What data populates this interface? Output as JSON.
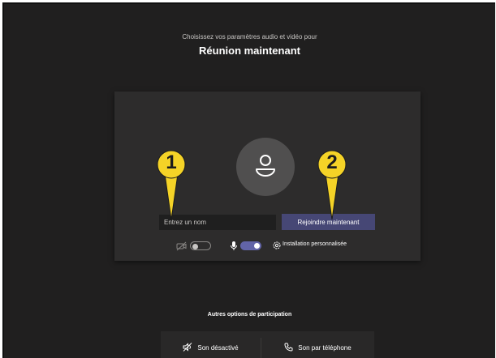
{
  "header": {
    "subtitle": "Choisissez vos paramètres audio et vidéo pour",
    "title": "Réunion maintenant"
  },
  "prejoin": {
    "name_placeholder": "Entrez un nom",
    "join_label": "Rejoindre maintenant",
    "camera_toggle": "off",
    "mic_toggle": "on",
    "custom_setup_label": "Installation personnalisée"
  },
  "callouts": [
    {
      "number": "1"
    },
    {
      "number": "2"
    }
  ],
  "other_options": {
    "title": "Autres options de participation",
    "audio_off_label": "Son désactivé",
    "phone_label": "Son par téléphone"
  },
  "colors": {
    "background": "#201f1f",
    "card": "#2d2c2c",
    "accent": "#464775",
    "toggle_on": "#6264a7",
    "callout_yellow": "#f5d327"
  }
}
